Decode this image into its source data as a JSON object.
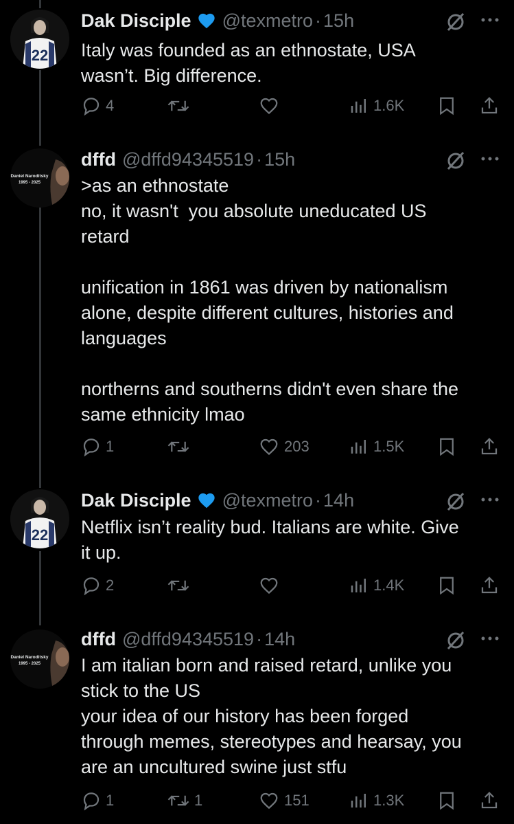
{
  "tweets": [
    {
      "name": "Dak Disciple",
      "verified": true,
      "handle": "@texmetro",
      "sep": "·",
      "time": "15h",
      "text": "Italy was founded as an ethnostate, USA\nwasn’t. Big difference.",
      "replies": "4",
      "reposts": "",
      "likes": "",
      "views": "1.6K",
      "avatar": "jersey-22"
    },
    {
      "name": "dffd",
      "verified": false,
      "handle": "@dffd94345519",
      "sep": "·",
      "time": "15h",
      "text": ">as an ethnostate\nno, it wasn't  you absolute uneducated US\nretard\n\nunification in 1861 was driven by nationalism\nalone, despite different cultures, histories and\nlanguages\n\nnortherns and southerns didn't even share the\nsame ethnicity lmao",
      "replies": "1",
      "reposts": "",
      "likes": "203",
      "views": "1.5K",
      "avatar": "memorial",
      "avatar_caption_line1": "Daniel Naroditsky",
      "avatar_caption_line2": "1995 - 2025"
    },
    {
      "name": "Dak Disciple",
      "verified": true,
      "handle": "@texmetro",
      "sep": "·",
      "time": "14h",
      "text": "Netflix isn’t reality bud. Italians are white. Give\nit up.",
      "replies": "2",
      "reposts": "",
      "likes": "",
      "views": "1.4K",
      "avatar": "jersey-22"
    },
    {
      "name": "dffd",
      "verified": false,
      "handle": "@dffd94345519",
      "sep": "·",
      "time": "14h",
      "text": "I am italian born and raised retard, unlike you\nstick to the US\nyour idea of our history has been forged\nthrough memes, stereotypes and hearsay, you\nare an uncultured swine just stfu",
      "replies": "1",
      "reposts": "1",
      "likes": "151",
      "views": "1.3K",
      "avatar": "memorial",
      "avatar_caption_line1": "Daniel Naroditsky",
      "avatar_caption_line2": "1995 - 2025"
    }
  ],
  "jersey_number": "22",
  "colors": {
    "background": "#000000",
    "text": "#e7e9ea",
    "muted": "#71767b",
    "verified": "#1d9bf0",
    "thread_line": "#333639"
  }
}
